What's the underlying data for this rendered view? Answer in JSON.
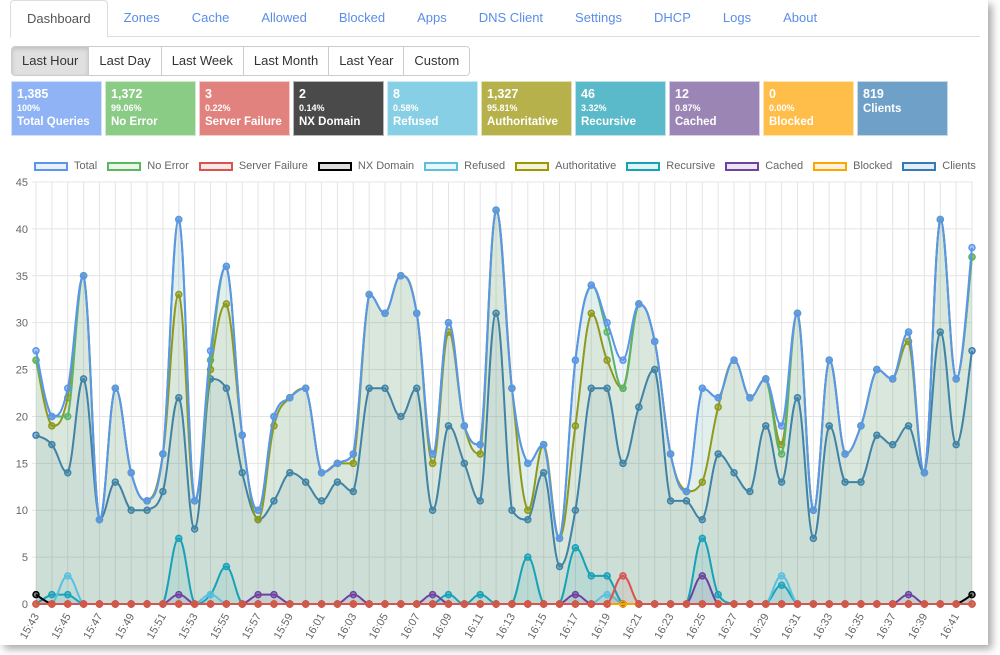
{
  "tabs": [
    "Dashboard",
    "Zones",
    "Cache",
    "Allowed",
    "Blocked",
    "Apps",
    "DNS Client",
    "Settings",
    "DHCP",
    "Logs",
    "About"
  ],
  "active_tab": "Dashboard",
  "ranges": [
    "Last Hour",
    "Last Day",
    "Last Week",
    "Last Month",
    "Last Year",
    "Custom"
  ],
  "active_range": "Last Hour",
  "tiles": [
    {
      "value": "1,385",
      "percent": "100%",
      "label": "Total Queries",
      "color": "#8fb3f5"
    },
    {
      "value": "1,372",
      "percent": "99.06%",
      "label": "No Error",
      "color": "#8acb86"
    },
    {
      "value": "3",
      "percent": "0.22%",
      "label": "Server Failure",
      "color": "#e2827e"
    },
    {
      "value": "2",
      "percent": "0.14%",
      "label": "NX Domain",
      "color": "#4a4a4a"
    },
    {
      "value": "8",
      "percent": "0.58%",
      "label": "Refused",
      "color": "#87cfe5"
    },
    {
      "value": "1,327",
      "percent": "95.81%",
      "label": "Authoritative",
      "color": "#b6b14a"
    },
    {
      "value": "46",
      "percent": "3.32%",
      "label": "Recursive",
      "color": "#5bbac9"
    },
    {
      "value": "12",
      "percent": "0.87%",
      "label": "Cached",
      "color": "#9b85b5"
    },
    {
      "value": "0",
      "percent": "0.00%",
      "label": "Blocked",
      "color": "#ffbd4a"
    },
    {
      "value": "819",
      "percent": "",
      "label": "Clients",
      "color": "#6ea0c8"
    }
  ],
  "chart_data": {
    "type": "line",
    "ylim": [
      0,
      45
    ],
    "yticks": [
      0,
      5,
      10,
      15,
      20,
      25,
      30,
      35,
      40,
      45
    ],
    "grid": true,
    "legend": "top",
    "x": [
      "15:43",
      "15:44",
      "15:45",
      "15:46",
      "15:47",
      "15:48",
      "15:49",
      "15:50",
      "15:51",
      "15:52",
      "15:53",
      "15:54",
      "15:55",
      "15:56",
      "15:57",
      "15:58",
      "15:59",
      "16:00",
      "16:01",
      "16:02",
      "16:03",
      "16:04",
      "16:05",
      "16:06",
      "16:07",
      "16:08",
      "16:09",
      "16:10",
      "16:11",
      "16:12",
      "16:13",
      "16:14",
      "16:15",
      "16:16",
      "16:17",
      "16:18",
      "16:19",
      "16:20",
      "16:21",
      "16:22",
      "16:23",
      "16:24",
      "16:25",
      "16:26",
      "16:27",
      "16:28",
      "16:29",
      "16:30",
      "16:31",
      "16:32",
      "16:33",
      "16:34",
      "16:35",
      "16:36",
      "16:37",
      "16:38",
      "16:39",
      "16:40",
      "16:41",
      "16:42"
    ],
    "xtick_labels": [
      "15:43",
      "15:45",
      "15:47",
      "15:49",
      "15:51",
      "15:53",
      "15:55",
      "15:57",
      "15:59",
      "16:01",
      "16:03",
      "16:05",
      "16:07",
      "16:09",
      "16:11",
      "16:13",
      "16:15",
      "16:17",
      "16:19",
      "16:21",
      "16:23",
      "16:25",
      "16:27",
      "16:29",
      "16:31",
      "16:33",
      "16:35",
      "16:37",
      "16:39",
      "16:41"
    ],
    "series": [
      {
        "name": "Total",
        "color": "#5b95ec",
        "values": [
          27,
          20,
          23,
          35,
          9,
          23,
          14,
          11,
          16,
          41,
          11,
          27,
          36,
          18,
          10,
          20,
          22,
          23,
          14,
          15,
          16,
          33,
          31,
          35,
          31,
          16,
          30,
          19,
          17,
          42,
          23,
          15,
          17,
          7,
          26,
          34,
          30,
          26,
          32,
          28,
          16,
          12,
          23,
          22,
          26,
          22,
          24,
          19,
          31,
          10,
          26,
          16,
          19,
          25,
          24,
          29,
          14,
          41,
          24,
          38
        ]
      },
      {
        "name": "No Error",
        "color": "#5cb85c",
        "values": [
          26,
          20,
          20,
          35,
          9,
          23,
          14,
          11,
          16,
          41,
          11,
          26,
          36,
          18,
          10,
          20,
          22,
          23,
          14,
          15,
          16,
          33,
          31,
          35,
          31,
          16,
          30,
          19,
          17,
          42,
          23,
          15,
          17,
          7,
          26,
          34,
          29,
          23,
          32,
          28,
          16,
          12,
          23,
          22,
          26,
          22,
          24,
          16,
          31,
          10,
          26,
          16,
          19,
          25,
          24,
          29,
          14,
          41,
          24,
          37
        ]
      },
      {
        "name": "Server Failure",
        "color": "#d9534f",
        "values": [
          0,
          0,
          0,
          0,
          0,
          0,
          0,
          0,
          0,
          0,
          0,
          0,
          0,
          0,
          0,
          0,
          0,
          0,
          0,
          0,
          0,
          0,
          0,
          0,
          0,
          0,
          0,
          0,
          0,
          0,
          0,
          0,
          0,
          0,
          0,
          0,
          0,
          3,
          0,
          0,
          0,
          0,
          0,
          0,
          0,
          0,
          0,
          0,
          0,
          0,
          0,
          0,
          0,
          0,
          0,
          0,
          0,
          0,
          0,
          0
        ]
      },
      {
        "name": "NX Domain",
        "color": "#000000",
        "values": [
          1,
          0,
          0,
          0,
          0,
          0,
          0,
          0,
          0,
          0,
          0,
          0,
          0,
          0,
          0,
          0,
          0,
          0,
          0,
          0,
          0,
          0,
          0,
          0,
          0,
          0,
          0,
          0,
          0,
          0,
          0,
          0,
          0,
          0,
          0,
          0,
          0,
          0,
          0,
          0,
          0,
          0,
          0,
          0,
          0,
          0,
          0,
          0,
          0,
          0,
          0,
          0,
          0,
          0,
          0,
          0,
          0,
          0,
          0,
          1
        ]
      },
      {
        "name": "Refused",
        "color": "#5bc0de",
        "values": [
          0,
          0,
          3,
          0,
          0,
          0,
          0,
          0,
          0,
          0,
          0,
          1,
          0,
          0,
          0,
          0,
          0,
          0,
          0,
          0,
          0,
          0,
          0,
          0,
          0,
          0,
          0,
          0,
          0,
          0,
          0,
          0,
          0,
          0,
          0,
          0,
          1,
          0,
          0,
          0,
          0,
          0,
          0,
          0,
          0,
          0,
          0,
          3,
          0,
          0,
          0,
          0,
          0,
          0,
          0,
          0,
          0,
          0,
          0,
          0
        ]
      },
      {
        "name": "Authoritative",
        "color": "#999900",
        "values": [
          26,
          19,
          22,
          35,
          9,
          23,
          14,
          11,
          16,
          33,
          11,
          25,
          32,
          18,
          9,
          19,
          22,
          23,
          14,
          15,
          15,
          33,
          31,
          35,
          31,
          15,
          29,
          19,
          16,
          42,
          23,
          10,
          17,
          7,
          19,
          31,
          26,
          23,
          32,
          28,
          16,
          12,
          13,
          21,
          26,
          22,
          24,
          17,
          31,
          10,
          26,
          16,
          19,
          25,
          24,
          28,
          14,
          41,
          24,
          37
        ]
      },
      {
        "name": "Recursive",
        "color": "#17a2b8",
        "values": [
          0,
          1,
          1,
          0,
          0,
          0,
          0,
          0,
          0,
          7,
          0,
          1,
          4,
          0,
          0,
          0,
          0,
          0,
          0,
          0,
          0,
          0,
          0,
          0,
          0,
          0,
          1,
          0,
          1,
          0,
          0,
          5,
          0,
          0,
          6,
          3,
          3,
          0,
          0,
          0,
          0,
          0,
          7,
          1,
          0,
          0,
          0,
          2,
          0,
          0,
          0,
          0,
          0,
          0,
          0,
          0,
          0,
          0,
          0,
          0
        ]
      },
      {
        "name": "Cached",
        "color": "#6f42a1",
        "values": [
          0,
          0,
          0,
          0,
          0,
          0,
          0,
          0,
          0,
          1,
          0,
          0,
          0,
          0,
          1,
          1,
          0,
          0,
          0,
          0,
          1,
          0,
          0,
          0,
          0,
          1,
          0,
          0,
          0,
          0,
          0,
          0,
          0,
          0,
          1,
          0,
          0,
          0,
          0,
          0,
          0,
          0,
          3,
          0,
          0,
          0,
          0,
          0,
          0,
          0,
          0,
          0,
          0,
          0,
          0,
          1,
          0,
          0,
          0,
          0
        ]
      },
      {
        "name": "Blocked",
        "color": "#ffa500",
        "values": [
          0,
          0,
          0,
          0,
          0,
          0,
          0,
          0,
          0,
          0,
          0,
          0,
          0,
          0,
          0,
          0,
          0,
          0,
          0,
          0,
          0,
          0,
          0,
          0,
          0,
          0,
          0,
          0,
          0,
          0,
          0,
          0,
          0,
          0,
          0,
          0,
          0,
          0,
          0,
          0,
          0,
          0,
          0,
          0,
          0,
          0,
          0,
          0,
          0,
          0,
          0,
          0,
          0,
          0,
          0,
          0,
          0,
          0,
          0,
          0
        ]
      },
      {
        "name": "Clients",
        "color": "#337ab7",
        "values": [
          18,
          17,
          14,
          24,
          9,
          13,
          10,
          10,
          12,
          22,
          8,
          24,
          23,
          14,
          9,
          11,
          14,
          13,
          11,
          13,
          12,
          23,
          23,
          20,
          23,
          10,
          19,
          15,
          11,
          31,
          10,
          9,
          14,
          4,
          10,
          23,
          23,
          15,
          21,
          25,
          11,
          11,
          9,
          16,
          14,
          12,
          19,
          13,
          22,
          7,
          19,
          13,
          13,
          18,
          17,
          19,
          14,
          29,
          17,
          27
        ]
      }
    ]
  }
}
